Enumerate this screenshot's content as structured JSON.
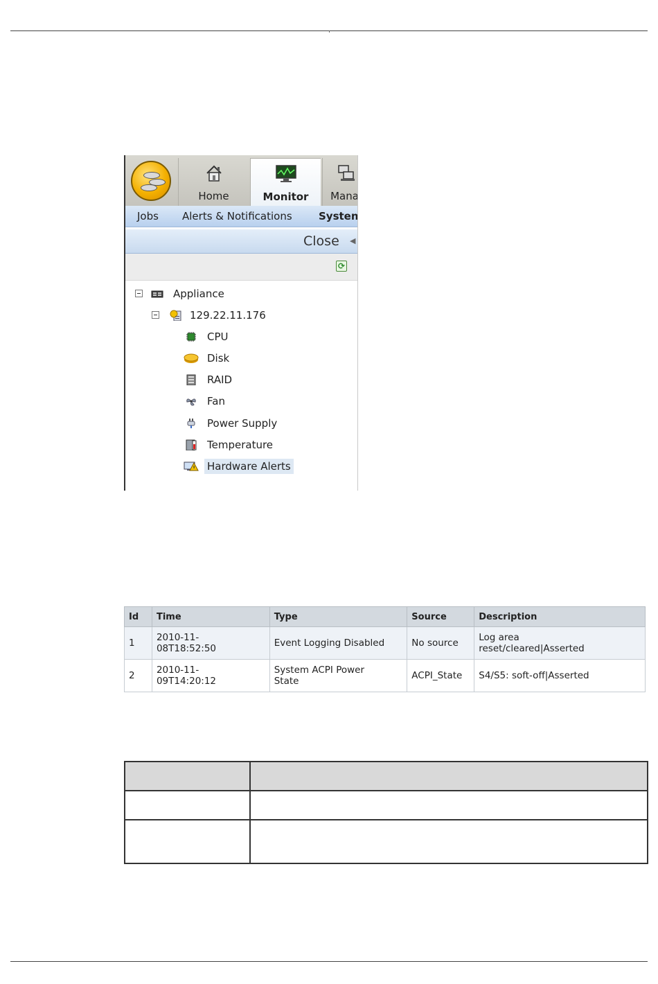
{
  "app": {
    "nav_tabs": [
      {
        "label": "Home",
        "icon": "home-icon"
      },
      {
        "label": "Monitor",
        "icon": "monitor-icon",
        "active": true
      },
      {
        "label": "Mana",
        "icon": "manage-icon"
      }
    ],
    "sub_nav": [
      "Jobs",
      "Alerts & Notifications",
      "Systen"
    ],
    "close_label": "Close",
    "tree": [
      {
        "label": "Appliance",
        "level": 0,
        "icon": "appliance-icon",
        "expanded": true
      },
      {
        "label": "129.22.11.176",
        "level": 1,
        "icon": "server-icon",
        "expanded": true
      },
      {
        "label": "CPU",
        "level": 2,
        "icon": "cpu-icon"
      },
      {
        "label": "Disk",
        "level": 2,
        "icon": "disk-icon"
      },
      {
        "label": "RAID",
        "level": 2,
        "icon": "raid-icon"
      },
      {
        "label": "Fan",
        "level": 2,
        "icon": "fan-icon"
      },
      {
        "label": "Power Supply",
        "level": 2,
        "icon": "power-supply-icon"
      },
      {
        "label": "Temperature",
        "level": 2,
        "icon": "temperature-icon"
      },
      {
        "label": "Hardware Alerts",
        "level": 2,
        "icon": "hardware-alerts-icon",
        "selected": true
      }
    ]
  },
  "alerts_table": {
    "headers": [
      "Id",
      "Time",
      "Type",
      "Source",
      "Description"
    ],
    "rows": [
      [
        "1",
        "2010-11-\n08T18:52:50",
        "Event Logging Disabled",
        "No source",
        "Log area\nreset/cleared|Asserted"
      ],
      [
        "2",
        "2010-11-\n09T14:20:12",
        "System ACPI Power\nState",
        "ACPI_State",
        "S4/S5: soft-off|Asserted"
      ]
    ]
  },
  "colors": {
    "accent_blue": "#b8d0ee",
    "header_gray": "#d3d9df",
    "selected_bg": "#dde8f3",
    "logo_gold": "#f4b000"
  }
}
